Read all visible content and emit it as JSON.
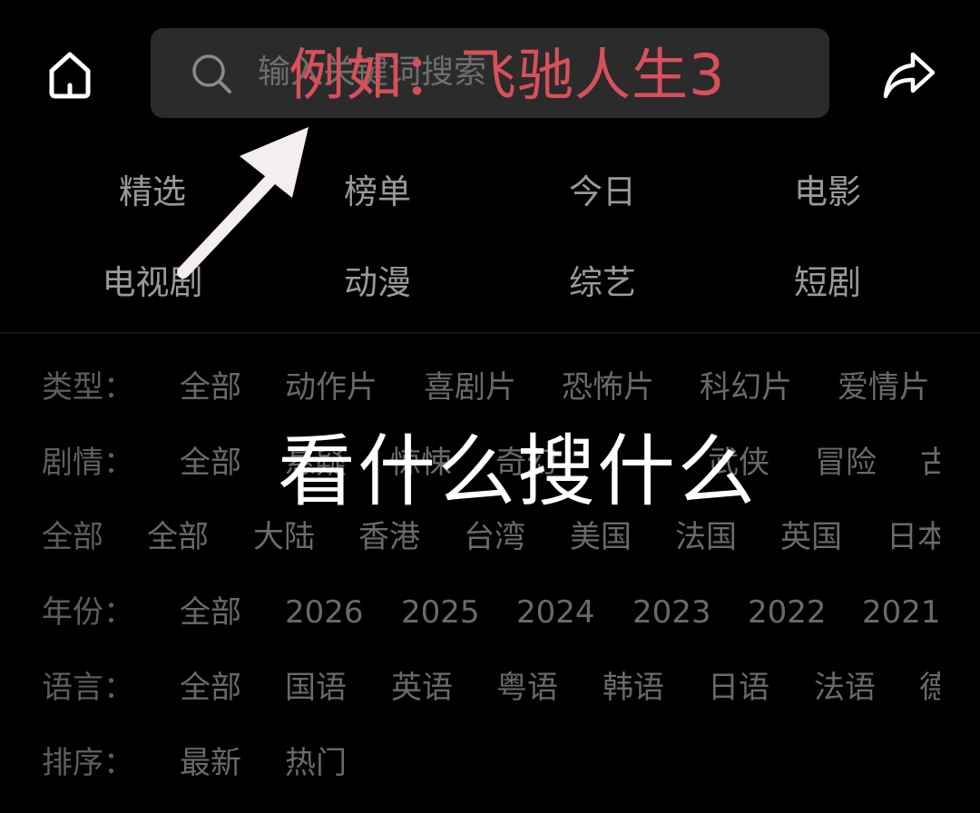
{
  "header": {
    "home_icon": "home-icon",
    "search_icon": "search-icon",
    "search_placeholder": "输入关键词搜索",
    "share_icon": "share-icon"
  },
  "nav": {
    "tabs": [
      "精选",
      "榜单",
      "今日",
      "电影",
      "电视剧",
      "动漫",
      "综艺",
      "短剧"
    ]
  },
  "filters": [
    {
      "label": "类型：",
      "options": [
        "全部",
        "动作片",
        "喜剧片",
        "恐怖片",
        "科幻片",
        "爱情片"
      ]
    },
    {
      "label": "剧情：",
      "options": [
        "全部",
        "悬疑",
        "惊悚",
        "奇幻",
        "武侠",
        "冒险",
        "古装"
      ]
    },
    {
      "label": "全部",
      "options": [
        "全部",
        "大陆",
        "香港",
        "台湾",
        "美国",
        "法国",
        "英国",
        "日本"
      ]
    },
    {
      "label": "年份：",
      "options": [
        "全部",
        "2026",
        "2025",
        "2024",
        "2023",
        "2022",
        "2021"
      ]
    },
    {
      "label": "语言：",
      "options": [
        "全部",
        "国语",
        "英语",
        "粤语",
        "韩语",
        "日语",
        "法语",
        "德语"
      ]
    },
    {
      "label": "排序：",
      "options": [
        "最新",
        "热门"
      ]
    }
  ],
  "overlay": {
    "hint": "例如：飞驰人生3",
    "caption": "看什么搜什么",
    "hint_color": "#d9505a"
  }
}
